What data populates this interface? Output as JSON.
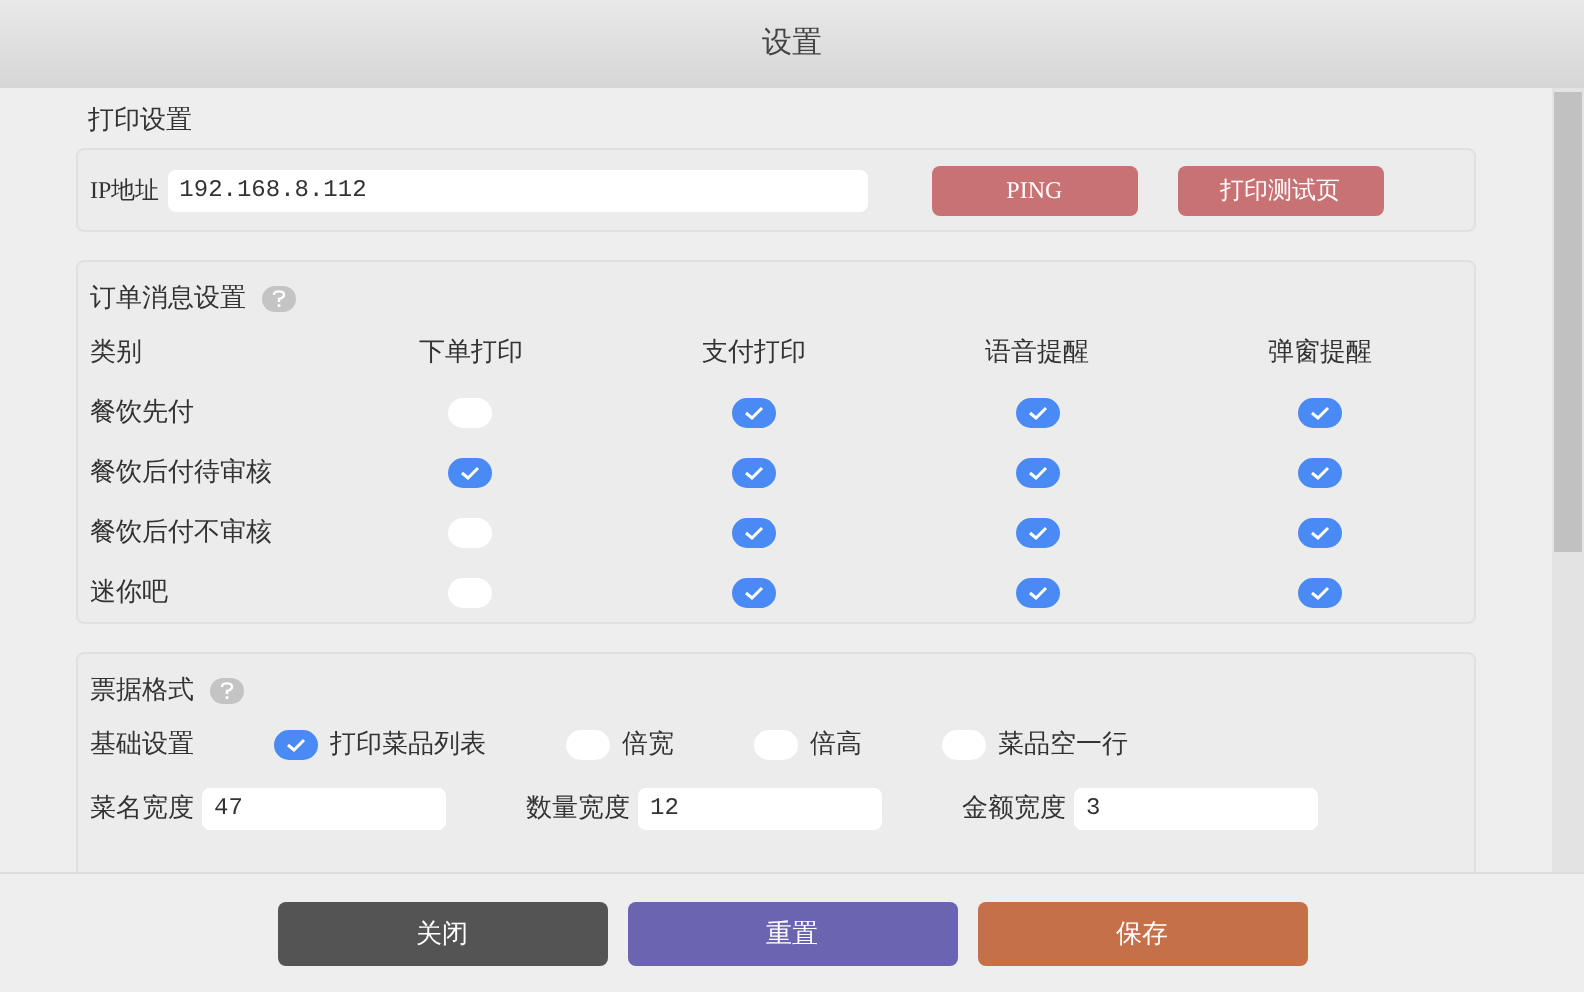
{
  "window": {
    "title": "设置"
  },
  "print_settings": {
    "title": "打印设置",
    "ip_label": "IP地址",
    "ip_value": "192.168.8.112",
    "buttons": [
      "PING",
      "打印测试页"
    ]
  },
  "order_message": {
    "title": "订单消息设置",
    "columns": [
      "类别",
      "下单打印",
      "支付打印",
      "语音提醒",
      "弹窗提醒"
    ],
    "rows": [
      {
        "name": "餐饮先付",
        "checks": [
          false,
          true,
          true,
          true
        ]
      },
      {
        "name": "餐饮后付待审核",
        "checks": [
          true,
          true,
          true,
          true
        ]
      },
      {
        "name": "餐饮后付不审核",
        "checks": [
          false,
          true,
          true,
          true
        ]
      },
      {
        "name": "迷你吧",
        "checks": [
          false,
          true,
          true,
          true
        ]
      }
    ]
  },
  "receipt_format": {
    "title": "票据格式",
    "basic_label": "基础设置",
    "options": [
      {
        "label": "打印菜品列表",
        "checked": true
      },
      {
        "label": "倍宽",
        "checked": false
      },
      {
        "label": "倍高",
        "checked": false
      },
      {
        "label": "菜品空一行",
        "checked": false
      }
    ],
    "fields": [
      {
        "label": "菜名宽度",
        "value": "47"
      },
      {
        "label": "数量宽度",
        "value": "12"
      },
      {
        "label": "金额宽度",
        "value": "3"
      }
    ]
  },
  "footer_buttons": [
    {
      "label": "关闭",
      "kind": "close"
    },
    {
      "label": "重置",
      "kind": "reset"
    },
    {
      "label": "保存",
      "kind": "save"
    }
  ]
}
